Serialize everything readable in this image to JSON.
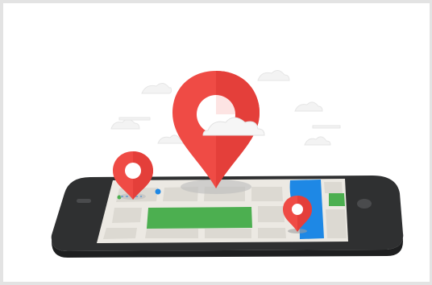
{
  "image": {
    "description_icon": "smartphone-map-location-pins-icon",
    "colors": {
      "frame_border": "#e3e3e3",
      "background": "#ffffff",
      "phone_body": "#2f3031",
      "map_land": "#ece9e3",
      "map_block": "#dcd9d2",
      "park": "#4caf50",
      "water": "#1e88e5",
      "pin_red": "#ef4b45",
      "pin_dark_red": "#d83a35",
      "cloud": "#f4f4f4"
    }
  }
}
